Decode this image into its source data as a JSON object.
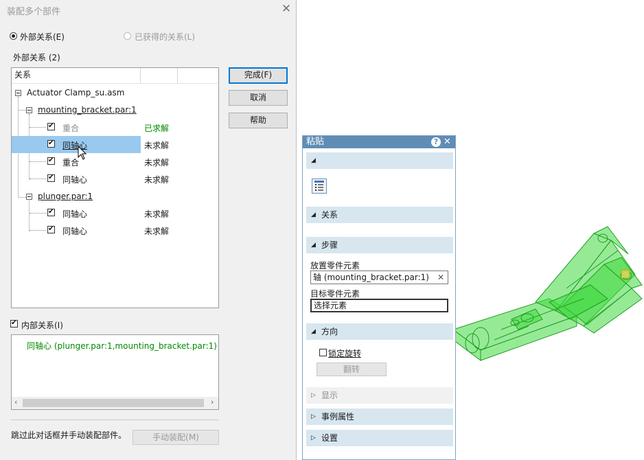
{
  "dialog": {
    "title": "装配多个部件",
    "radio_external": "外部关系(E)",
    "radio_obtained": "已获得的关系(L)",
    "external_group_label": "外部关系 (2)",
    "column_header": "关系",
    "tree": {
      "root": "Actuator Clamp_su.asm",
      "parts": [
        {
          "name": "mounting_bracket.par:1",
          "relations": [
            {
              "type": "重合",
              "status": "已求解",
              "checked": true,
              "solved": true,
              "selected": false
            },
            {
              "type": "同轴心",
              "status": "未求解",
              "checked": true,
              "solved": false,
              "selected": true
            },
            {
              "type": "重合",
              "status": "未求解",
              "checked": true,
              "solved": false,
              "selected": false
            },
            {
              "type": "同轴心",
              "status": "未求解",
              "checked": true,
              "solved": false,
              "selected": false
            }
          ]
        },
        {
          "name": "plunger.par:1",
          "relations": [
            {
              "type": "同轴心",
              "status": "未求解",
              "checked": true,
              "solved": false,
              "selected": false
            },
            {
              "type": "同轴心",
              "status": "未求解",
              "checked": true,
              "solved": false,
              "selected": false
            }
          ]
        }
      ]
    },
    "buttons": {
      "finish": "完成(F)",
      "cancel": "取消",
      "help": "帮助"
    },
    "internal_checkbox": "内部关系(I)",
    "internal_item": "同轴心 (plunger.par:1,mounting_bracket.par:1)",
    "skip_text": "跳过此对话框并手动装配部件。",
    "manual_assembly_button": "手动装配(M)"
  },
  "panel": {
    "title": "粘贴",
    "sections": {
      "relation": "关系",
      "steps": "步骤",
      "direction": "方向",
      "display": "显示",
      "instance_properties": "事例属性",
      "settings": "设置"
    },
    "place_label": "放置零件元素",
    "place_value": "轴 (mounting_bracket.par:1)",
    "target_label": "目标零件元素",
    "target_value": "选择元素",
    "lock_rotation": "锁定旋转",
    "flip_button": "翻转"
  },
  "colors": {
    "accent": "#0078d7",
    "panel_title": "#5f8db5",
    "section_bg": "#d7e6ef",
    "selection": "#99c9ef",
    "solved": "#008a00",
    "model_green": "#3fd83f"
  }
}
